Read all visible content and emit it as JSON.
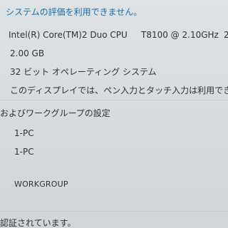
{
  "system": {
    "rating_text": "システムの評価を利用できません。",
    "processor": {
      "model": "Intel(R) Core(TM)2 Duo CPU",
      "speed": "T8100  @ 2.10GHz",
      "cut": "2"
    },
    "memory": "2.00 GB",
    "system_type": "32 ビット オペレーティング システム",
    "pen_touch": "このディスプレイでは、ペン入力とタッチ入力は利用でき"
  },
  "computer_settings": {
    "section_title": "およびワークグループの設定",
    "computer_name": "1-PC",
    "full_name": "1-PC",
    "workgroup": "WORKGROUP"
  },
  "footer": {
    "activation_text": "認証されています。"
  }
}
